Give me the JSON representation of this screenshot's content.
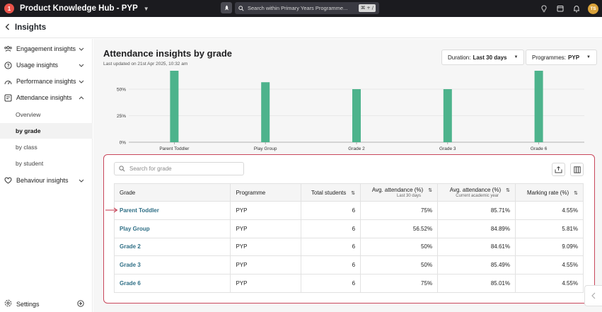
{
  "app": {
    "title": "Product Knowledge Hub - PYP",
    "logo_letter": "1",
    "brand_color": "#e9534a"
  },
  "topbar": {
    "search_placeholder": "Search within Primary Years Programme...",
    "shortcut": "⌘ + /",
    "avatar_initials": "TS"
  },
  "subbar": {
    "title": "Insights"
  },
  "sidebar": {
    "items": [
      {
        "label": "Engagement insights",
        "icon": "group-icon",
        "expanded": false
      },
      {
        "label": "Usage insights",
        "icon": "help-circle-icon",
        "expanded": false
      },
      {
        "label": "Performance insights",
        "icon": "gauge-icon",
        "expanded": false
      },
      {
        "label": "Attendance insights",
        "icon": "attendance-icon",
        "expanded": true
      },
      {
        "label": "Behaviour insights",
        "icon": "heart-icon",
        "expanded": false
      }
    ],
    "attendance_subitems": [
      {
        "label": "Overview",
        "active": false
      },
      {
        "label": "by grade",
        "active": true
      },
      {
        "label": "by class",
        "active": false
      },
      {
        "label": "by student",
        "active": false
      }
    ],
    "settings_label": "Settings"
  },
  "page": {
    "title": "Attendance insights by grade",
    "subtitle": "Last updated on 21st Apr 2025, 10:32 am",
    "duration_label": "Duration:",
    "duration_value": "Last 30 days",
    "programmes_label": "Programmes:",
    "programmes_value": "PYP"
  },
  "chart_data": {
    "type": "bar",
    "categories": [
      "Parent Toddler",
      "Play Group",
      "Grade 2",
      "Grade 3",
      "Grade 6"
    ],
    "values": [
      75,
      56.52,
      50,
      50,
      75
    ],
    "ylim": [
      0,
      50
    ],
    "yticks": [
      "0%",
      "25%",
      "50%"
    ],
    "bar_color": "#4db38c",
    "grid": true,
    "clipped_top": true
  },
  "table": {
    "search_placeholder": "Search for grade",
    "columns": [
      {
        "label": "Grade",
        "sub": "",
        "align": "left",
        "sortable": false
      },
      {
        "label": "Programme",
        "sub": "",
        "align": "left",
        "sortable": false
      },
      {
        "label": "Total students",
        "sub": "",
        "align": "right",
        "sortable": true
      },
      {
        "label": "Avg. attendance (%)",
        "sub": "Last 30 days",
        "align": "right",
        "sortable": true
      },
      {
        "label": "Avg. attendance (%)",
        "sub": "Current academic year",
        "align": "right",
        "sortable": true
      },
      {
        "label": "Marking rate (%)",
        "sub": "",
        "align": "right",
        "sortable": true
      }
    ],
    "rows": [
      [
        "Parent Toddler",
        "PYP",
        "6",
        "75%",
        "85.71%",
        "4.55%"
      ],
      [
        "Play Group",
        "PYP",
        "6",
        "56.52%",
        "84.89%",
        "5.81%"
      ],
      [
        "Grade 2",
        "PYP",
        "6",
        "50%",
        "84.61%",
        "9.09%"
      ],
      [
        "Grade 3",
        "PYP",
        "6",
        "50%",
        "85.49%",
        "4.55%"
      ],
      [
        "Grade 6",
        "PYP",
        "6",
        "75%",
        "85.01%",
        "4.55%"
      ]
    ],
    "highlight_color": "#c9475b"
  }
}
